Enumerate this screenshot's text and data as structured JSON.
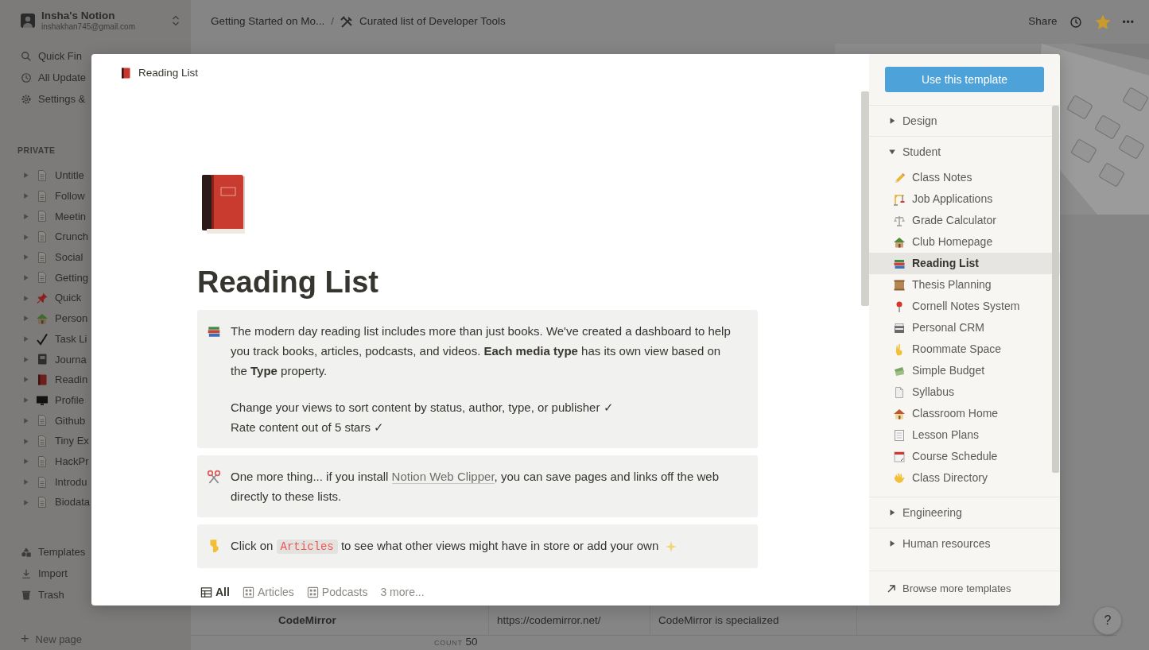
{
  "sidebar": {
    "workspace": {
      "name": "Insha's Notion",
      "email": "inshakhan745@gmail.com"
    },
    "top_items": [
      {
        "label": "Quick Fin",
        "kind": "search"
      },
      {
        "label": "All Update",
        "kind": "clock"
      },
      {
        "label": "Settings &",
        "kind": "gear"
      }
    ],
    "section_label": "PRIVATE",
    "pages": [
      {
        "label": "Untitle",
        "kind": "page"
      },
      {
        "label": "Follow",
        "kind": "page"
      },
      {
        "label": "Meetin",
        "kind": "page"
      },
      {
        "label": "Crunch",
        "kind": "page"
      },
      {
        "label": "Social",
        "kind": "page"
      },
      {
        "label": "Getting",
        "kind": "page"
      },
      {
        "label": "Quick",
        "kind": "pin"
      },
      {
        "label": "Person",
        "kind": "house"
      },
      {
        "label": "Task Li",
        "kind": "check"
      },
      {
        "label": "Journa",
        "kind": "journal"
      },
      {
        "label": "Readin",
        "kind": "book"
      },
      {
        "label": "Profile",
        "kind": "monitor"
      },
      {
        "label": "Github",
        "kind": "page"
      },
      {
        "label": "Tiny Ex",
        "kind": "page"
      },
      {
        "label": "HackPr",
        "kind": "page"
      },
      {
        "label": "Introdu",
        "kind": "page"
      },
      {
        "label": "Biodata",
        "kind": "page"
      }
    ],
    "bottom_items": [
      {
        "label": "Templates",
        "kind": "templates"
      },
      {
        "label": "Import",
        "kind": "import"
      },
      {
        "label": "Trash",
        "kind": "trash"
      }
    ],
    "new_page": {
      "icon": "+",
      "label": "New page"
    }
  },
  "topbar": {
    "breadcrumb": [
      "Getting Started on Mo...",
      "/",
      "Curated list of Developer Tools"
    ],
    "share": "Share",
    "favorited": true,
    "more": "•••"
  },
  "background_table": {
    "row": [
      "CodeMirror",
      "https://codemirror.net/",
      "CodeMirror is specialized"
    ],
    "count_label": "COUNT",
    "count": "50"
  },
  "help": "?",
  "modal": {
    "header_title": "Reading List",
    "page_title": "Reading List",
    "callouts": [
      {
        "kind": "books",
        "paragraphs": [
          [
            [
              {
                "kind": "text",
                "text": "The modern day reading list includes more than just books. We've created a dashboard to help you track books, articles, podcasts, and videos. **Each media type** has its own view based on the **Type** property."
              }
            ]
          ],
          [
            [
              {
                "kind": "text",
                "text": "Change your views to sort content by status, author, type, or publisher ✓"
              }
            ],
            [
              {
                "kind": "text",
                "text": "Rate content out of 5 stars ✓"
              }
            ]
          ]
        ]
      },
      {
        "kind": "scissors",
        "paragraphs": [
          [
            [
              {
                "kind": "text",
                "text": "One more thing... if you install "
              },
              {
                "kind": "link",
                "text": "Notion Web Clipper"
              },
              {
                "kind": "text",
                "text": ", you can save pages and links off the web directly to these lists."
              }
            ]
          ]
        ]
      },
      {
        "kind": "hand",
        "paragraphs": [
          [
            [
              {
                "kind": "text",
                "text": "Click on "
              },
              {
                "kind": "code",
                "text": "Articles"
              },
              {
                "kind": "text",
                "text": " to see what other views might have in store or add your own"
              }
            ]
          ]
        ]
      }
    ],
    "tabs": [
      {
        "label": "All",
        "kind": "table",
        "selected": true
      },
      {
        "label": "Articles",
        "kind": "gallery",
        "selected": false
      },
      {
        "label": "Podcasts",
        "kind": "gallery",
        "selected": false
      },
      {
        "label": "3 more...",
        "kind": "more",
        "selected": false
      }
    ]
  },
  "templates": {
    "use_button": "Use this template",
    "categories": [
      {
        "label": "Design",
        "expanded": false
      },
      {
        "label": "Student",
        "expanded": true,
        "children": [
          {
            "label": "Class Notes",
            "kind": "pencil",
            "selected": false
          },
          {
            "label": "Job Applications",
            "kind": "crane",
            "selected": false
          },
          {
            "label": "Grade Calculator",
            "kind": "scale",
            "selected": false
          },
          {
            "label": "Club Homepage",
            "kind": "house",
            "selected": false
          },
          {
            "label": "Reading List",
            "kind": "books",
            "selected": true
          },
          {
            "label": "Thesis Planning",
            "kind": "scroll",
            "selected": false
          },
          {
            "label": "Cornell Notes System",
            "kind": "pin",
            "selected": false
          },
          {
            "label": "Personal CRM",
            "kind": "cabinet",
            "selected": false
          },
          {
            "label": "Roommate Space",
            "kind": "hand",
            "selected": false
          },
          {
            "label": "Simple Budget",
            "kind": "money",
            "selected": false
          },
          {
            "label": "Syllabus",
            "kind": "page",
            "selected": false
          },
          {
            "label": "Classroom Home",
            "kind": "home",
            "selected": false
          },
          {
            "label": "Lesson Plans",
            "kind": "notepad",
            "selected": false
          },
          {
            "label": "Course Schedule",
            "kind": "calendar",
            "selected": false
          },
          {
            "label": "Class Directory",
            "kind": "wave",
            "selected": false
          }
        ]
      },
      {
        "label": "Engineering",
        "expanded": false
      },
      {
        "label": "Human resources",
        "expanded": false
      }
    ],
    "browse": "Browse more templates"
  }
}
